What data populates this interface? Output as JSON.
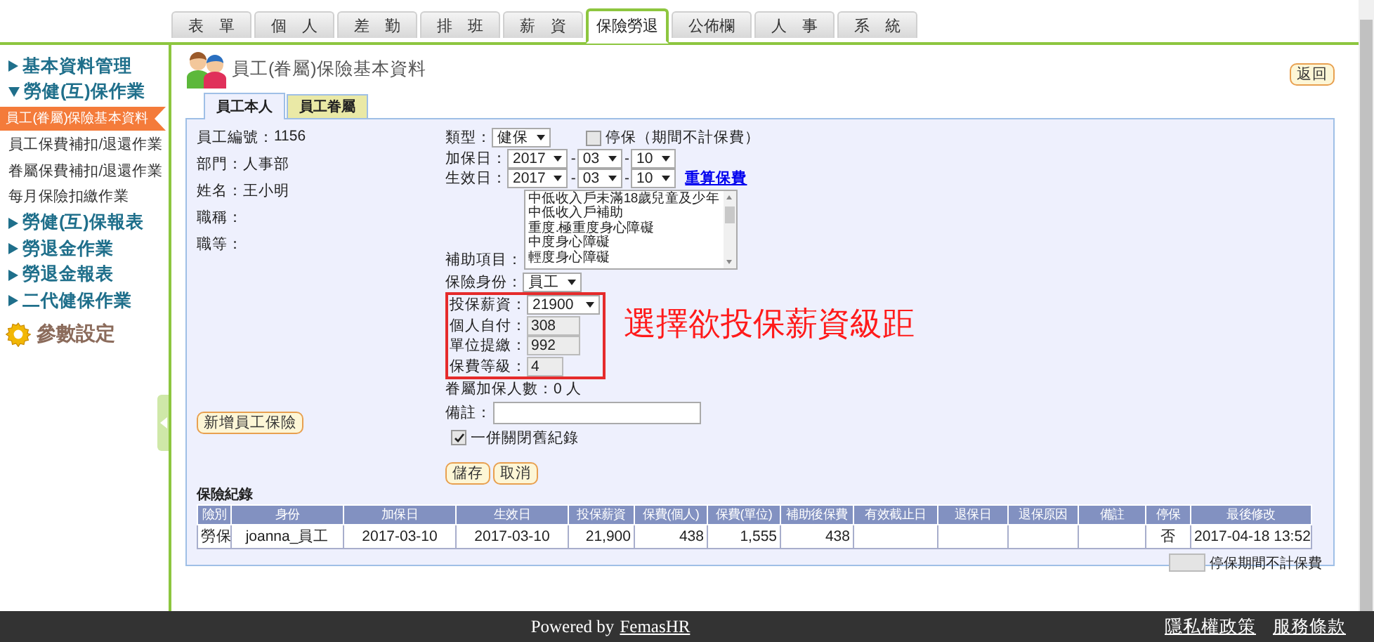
{
  "top_tabs": [
    {
      "label": "表　單",
      "selected": false
    },
    {
      "label": "個　人",
      "selected": false
    },
    {
      "label": "差　勤",
      "selected": false
    },
    {
      "label": "排　班",
      "selected": false
    },
    {
      "label": "薪　資",
      "selected": false
    },
    {
      "label": "保險勞退",
      "selected": true
    },
    {
      "label": "公佈欄",
      "selected": false
    },
    {
      "label": "人　事",
      "selected": false
    },
    {
      "label": "系　統",
      "selected": false
    }
  ],
  "sidebar": {
    "items": [
      {
        "kind": "section",
        "label": "基本資料管理",
        "expanded": false
      },
      {
        "kind": "section",
        "label": "勞健(互)保作業",
        "expanded": true
      },
      {
        "kind": "link",
        "label": "員工(眷屬)保險基本資料",
        "selected": true
      },
      {
        "kind": "link",
        "label": "員工保費補扣/退還作業",
        "selected": false
      },
      {
        "kind": "link",
        "label": "眷屬保費補扣/退還作業",
        "selected": false
      },
      {
        "kind": "link",
        "label": "每月保險扣繳作業",
        "selected": false
      },
      {
        "kind": "section",
        "label": "勞健(互)保報表",
        "expanded": false
      },
      {
        "kind": "section",
        "label": "勞退金作業",
        "expanded": false
      },
      {
        "kind": "section",
        "label": "勞退金報表",
        "expanded": false
      },
      {
        "kind": "section",
        "label": "二代健保作業",
        "expanded": false
      },
      {
        "kind": "settings",
        "label": "參數設定"
      }
    ]
  },
  "page": {
    "title": "員工(眷屬)保險基本資料",
    "back_button": "返回"
  },
  "subtabs": [
    {
      "label": "員工本人",
      "selected": true
    },
    {
      "label": "員工眷屬",
      "selected": false
    }
  ],
  "employee": [
    {
      "label": "員工編號：",
      "value": "1156"
    },
    {
      "label": "部門：",
      "value": "人事部"
    },
    {
      "label": "姓名：",
      "value": "王小明"
    },
    {
      "label": "職稱："
    },
    {
      "label": "職等："
    }
  ],
  "add_button": "新增員工保險",
  "form": {
    "type": {
      "label": "類型：",
      "value": "健保"
    },
    "suspend": {
      "label": "停保（期間不計保費）",
      "checked": false
    },
    "enroll_date": {
      "label": "加保日：",
      "year": "2017",
      "separator": "-",
      "month": "03",
      "separator_2": "-",
      "day": "10"
    },
    "effective_date": {
      "label": "生效日：",
      "year": "2017",
      "separator": "-",
      "month": "03",
      "separator_2": "-",
      "day": "10",
      "link": "重算保費"
    },
    "subsidy": {
      "label": "補助項目：",
      "options": [
        "中低收入戶未滿18歲兒童及少年",
        "中低收入戶補助",
        "重度.極重度身心障礙",
        "中度身心障礙",
        "輕度身心障礙"
      ]
    },
    "identity": {
      "label": "保險身份：",
      "value": "員工"
    },
    "salary": {
      "label": "投保薪資：",
      "value": "21900"
    },
    "fees": [
      {
        "label": "個人自付：",
        "value": "308"
      },
      {
        "label": "單位提繳：",
        "value": "992"
      },
      {
        "label": "保費等級：",
        "value": "4"
      }
    ],
    "dependents": {
      "label": "眷屬加保人數：",
      "value": "0 人"
    },
    "note": {
      "label": "備註："
    },
    "close_old": {
      "label": "一併關閉舊紀錄",
      "checked": true
    },
    "buttons": [
      "儲存",
      "取消"
    ]
  },
  "annotation": "選擇欲投保薪資級距",
  "records": {
    "title": "保險紀錄",
    "columns": [
      "險別",
      "身份",
      "加保日",
      "生效日",
      "投保薪資",
      "保費(個人)",
      "保費(單位)",
      "補助後保費",
      "有效截止日",
      "退保日",
      "退保原因",
      "備註",
      "停保",
      "最後修改"
    ],
    "rows": [
      [
        "勞保",
        "joanna_員工",
        "2017-03-10",
        "2017-03-10",
        "21,900",
        "438",
        "1,555",
        "438",
        null,
        null,
        null,
        null,
        "否",
        "2017-04-18 13:52"
      ]
    ]
  },
  "legend": "停保期間不計保費",
  "footer": {
    "powered": "Powered by",
    "brand": "FemasHR",
    "links": [
      "隱私權政策",
      "服務條款"
    ]
  }
}
